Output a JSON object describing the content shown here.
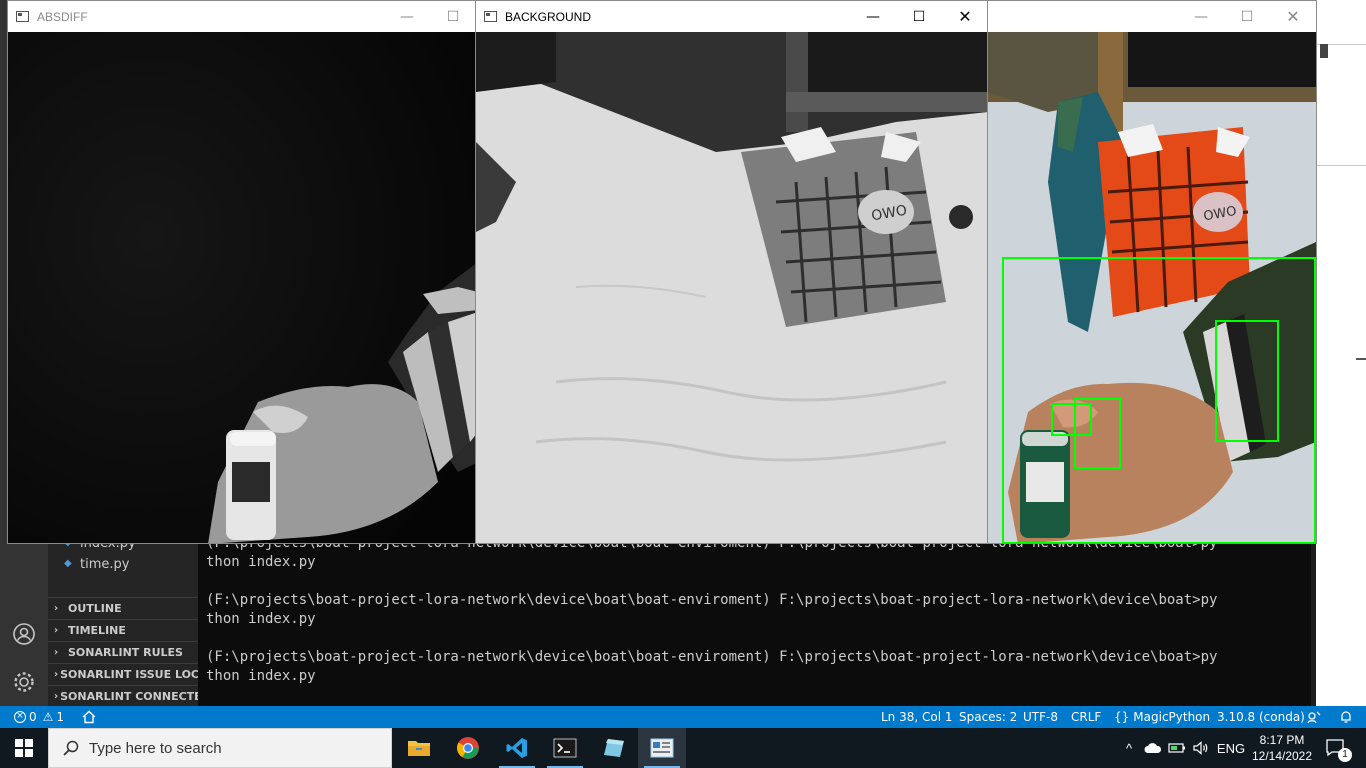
{
  "vscode": {
    "files": [
      "index.py",
      "time.py"
    ],
    "sections": [
      "OUTLINE",
      "TIMELINE",
      "SONARLINT RULES",
      "SONARLINT ISSUE LOCATIONS",
      "SONARLINT CONNECTED MODE"
    ],
    "terminal_lines": [
      "(F:\\projects\\boat-project-lora-network\\device\\boat\\boat-enviroment) F:\\projects\\boat-project-lora-network\\device\\boat>py",
      "thon index.py",
      "",
      "(F:\\projects\\boat-project-lora-network\\device\\boat\\boat-enviroment) F:\\projects\\boat-project-lora-network\\device\\boat>py",
      "thon index.py",
      "",
      "(F:\\projects\\boat-project-lora-network\\device\\boat\\boat-enviroment) F:\\projects\\boat-project-lora-network\\device\\boat>py",
      "thon index.py"
    ],
    "status": {
      "errors": "0",
      "warnings": "1",
      "cursor": "Ln 38, Col 1",
      "spaces": "Spaces: 2",
      "encoding": "UTF-8",
      "eol": "CRLF",
      "language": "MagicPython",
      "interpreter": "3.10.8 (conda)"
    }
  },
  "windows": {
    "absdiff": {
      "title": "ABSDIFF"
    },
    "background": {
      "title": "BACKGROUND"
    },
    "frame": {
      "title": ""
    }
  },
  "taskbar": {
    "search_placeholder": "Type here to search",
    "language": "ENG",
    "time": "8:17 PM",
    "date": "12/14/2022",
    "notification_count": "1"
  },
  "colors": {
    "statusbar": "#007acc",
    "detection_box": "#00ff00",
    "taskbar": "#101820"
  }
}
